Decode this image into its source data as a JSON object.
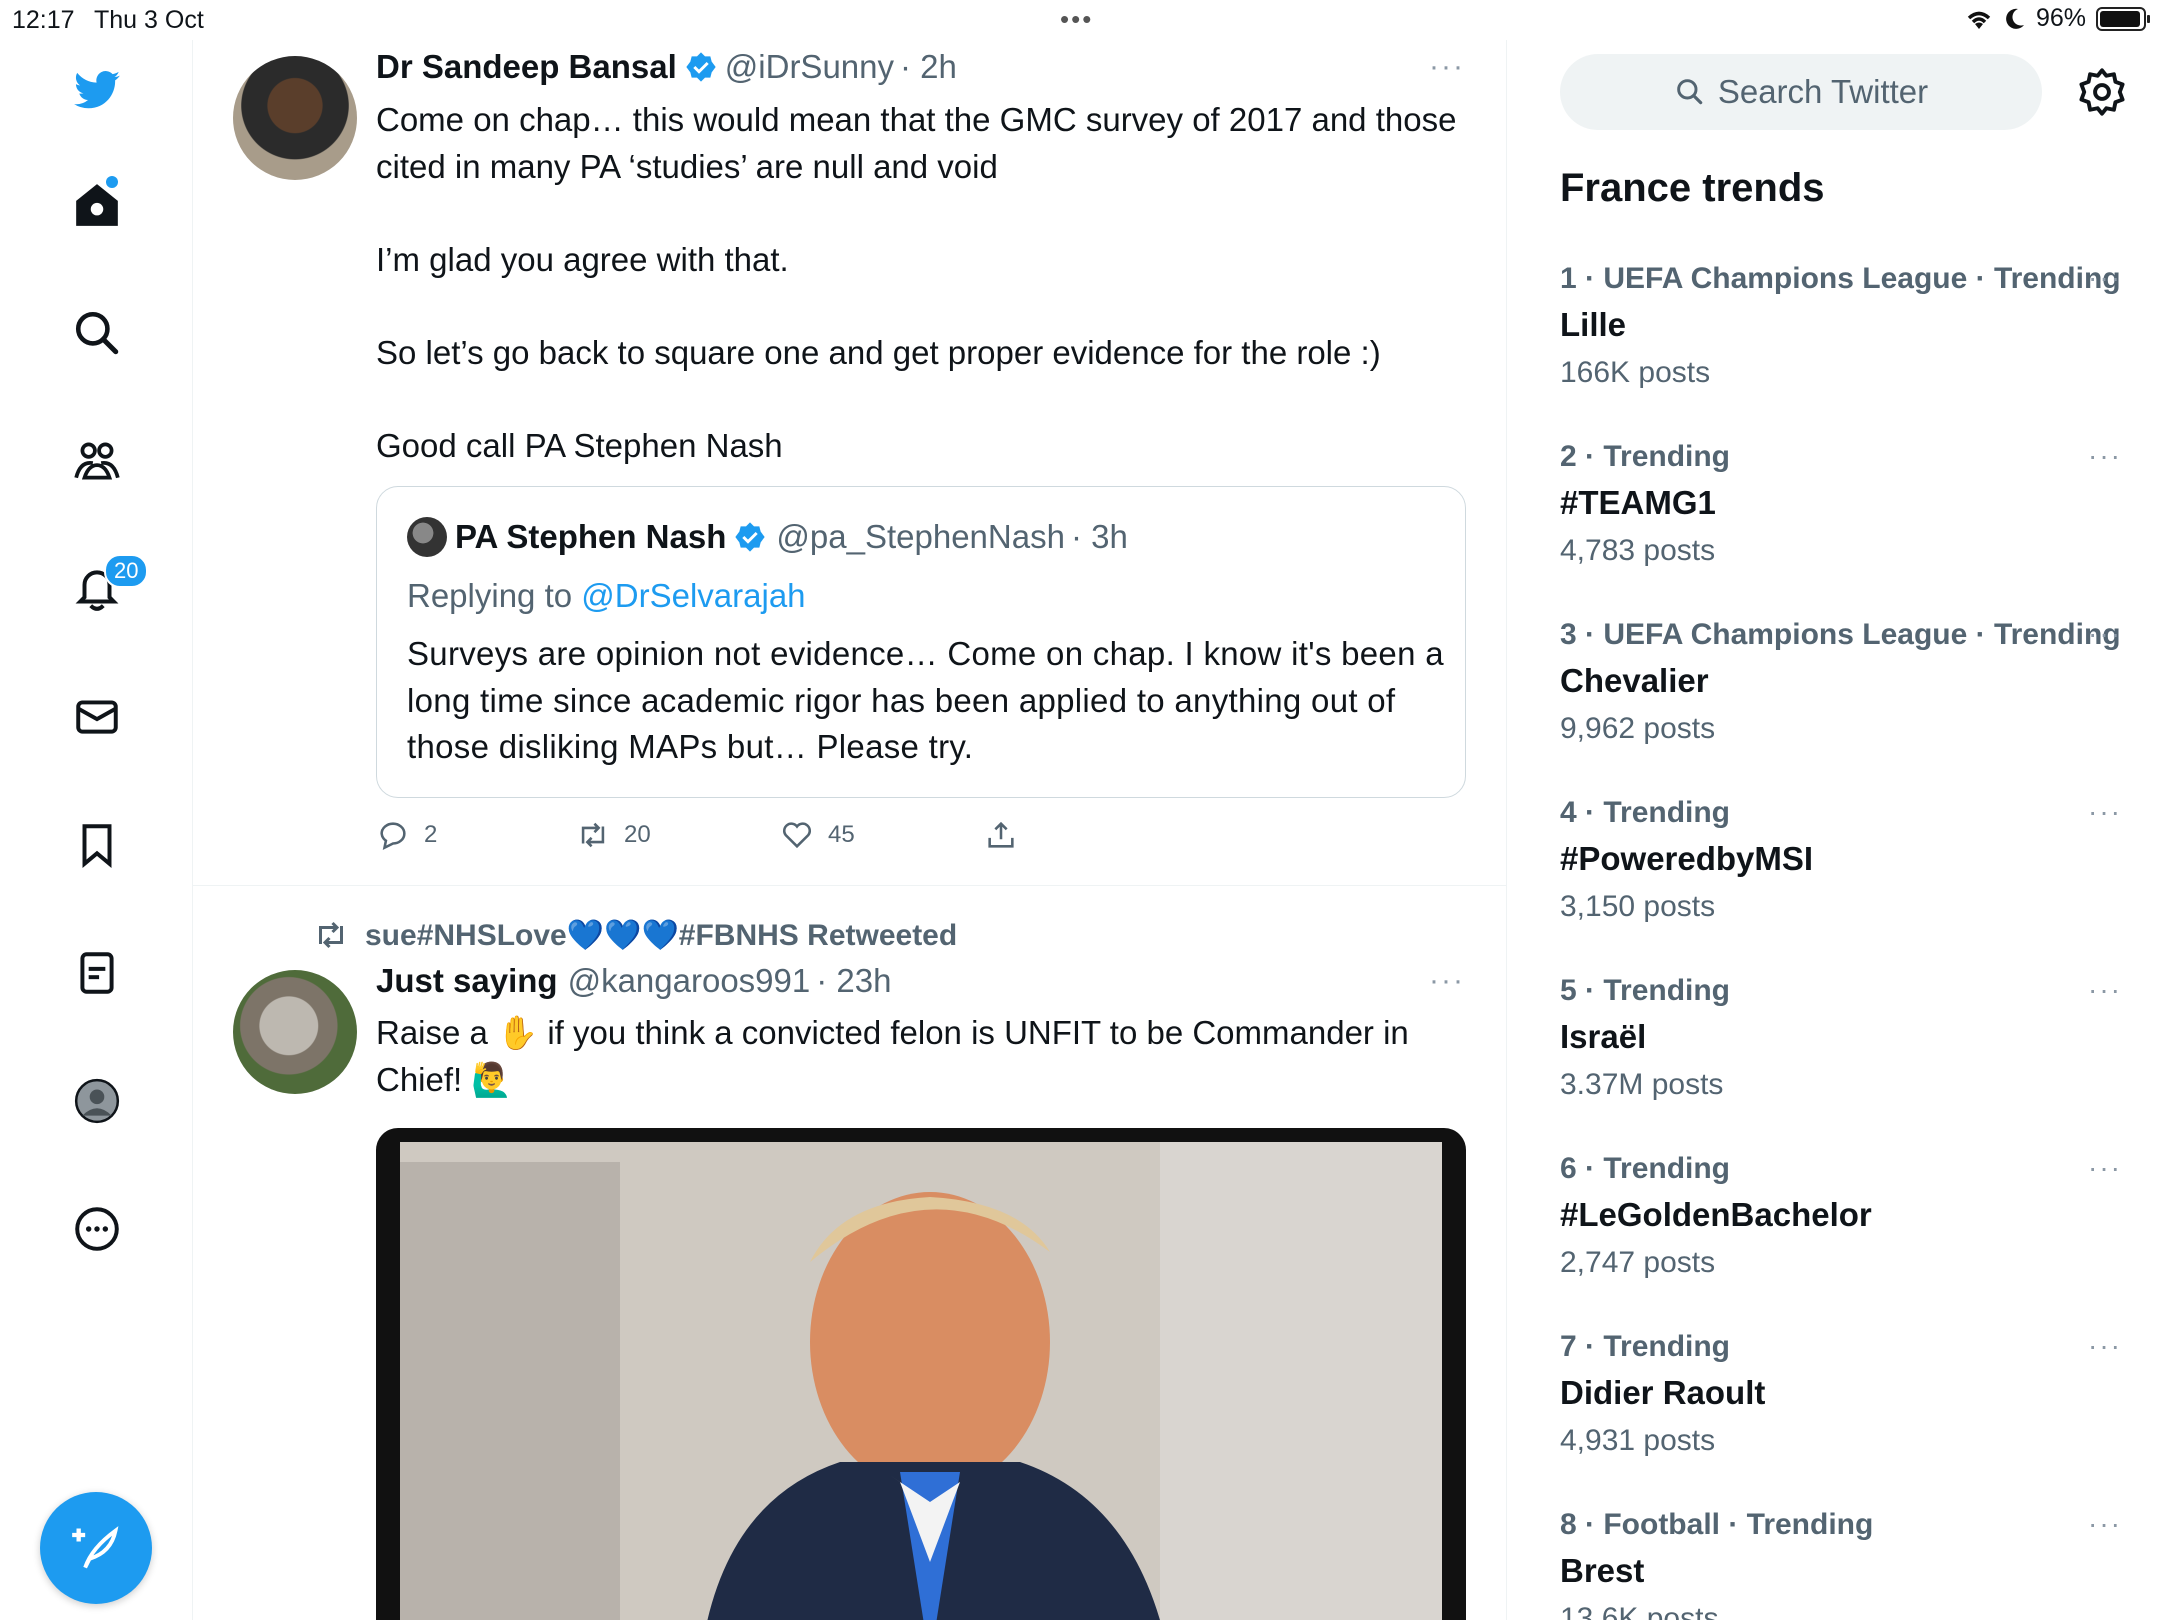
{
  "status_bar": {
    "time": "12:17",
    "date": "Thu 3 Oct",
    "battery": "96%",
    "battery_level": 0.96
  },
  "nav": {
    "notifications_badge": "20",
    "icons": [
      "twitter-logo",
      "home-icon",
      "search-icon",
      "communities-icon",
      "bell-icon",
      "mail-icon",
      "bookmark-icon",
      "lists-icon",
      "profile-icon",
      "more-circle-icon",
      "compose-icon"
    ]
  },
  "tweet1": {
    "name": "Dr Sandeep Bansal",
    "handle": "@iDrSunny",
    "time": "· 2h",
    "more": "···",
    "paragraphs": [
      "Come on chap… this would mean that the GMC survey of 2017 and those cited in many PA ‘studies’ are null and void",
      "I’m glad you agree with that.",
      "So let’s go back to square one and get proper evidence for the role :)",
      "Good call PA Stephen Nash"
    ],
    "quote": {
      "name": "PA Stephen Nash",
      "handle": "@pa_StephenNash",
      "time": "· 3h",
      "replying_prefix": "Replying to",
      "replying_to": "@DrSelvarajah",
      "text": "Surveys are opinion not evidence… Come on chap. I know it's been a long time since academic rigor has been applied to anything out of those disliking MAPs but… Please try."
    },
    "actions": {
      "replies": "2",
      "retweets": "20",
      "likes": "45"
    }
  },
  "tweet2": {
    "retweeted_by": "sue#NHSLove💙💙💙#FBNHS Retweeted",
    "name": "Just saying",
    "handle": "@kangaroos991",
    "time": "· 23h",
    "more": "···",
    "text_part1": "Raise a ✋ if you think a convicted felon is UNFIT to be Commander in Chief! 🙋‍♂️"
  },
  "sidebar": {
    "search_placeholder": "Search Twitter",
    "trends_title": "France trends",
    "trends": [
      {
        "meta": "1 · UEFA Champions League · Trending",
        "topic": "Lille",
        "count": "166K posts"
      },
      {
        "meta": "2 · Trending",
        "topic": "#TEAMG1",
        "count": "4,783 posts"
      },
      {
        "meta": "3 · UEFA Champions League · Trending",
        "topic": "Chevalier",
        "count": "9,962 posts"
      },
      {
        "meta": "4 · Trending",
        "topic": "#PoweredbyMSI",
        "count": "3,150 posts"
      },
      {
        "meta": "5 · Trending",
        "topic": "Israël",
        "count": "3.37M posts"
      },
      {
        "meta": "6 · Trending",
        "topic": "#LeGoldenBachelor",
        "count": "2,747 posts"
      },
      {
        "meta": "7 · Trending",
        "topic": "Didier Raoult",
        "count": "4,931 posts"
      },
      {
        "meta": "8 · Football · Trending",
        "topic": "Brest",
        "count": "13.6K posts"
      }
    ],
    "trend_more": "···"
  },
  "colors": {
    "accent": "#1d9bf0",
    "text": "#0f1419",
    "secondary": "#536471",
    "border": "#eff3f4"
  }
}
